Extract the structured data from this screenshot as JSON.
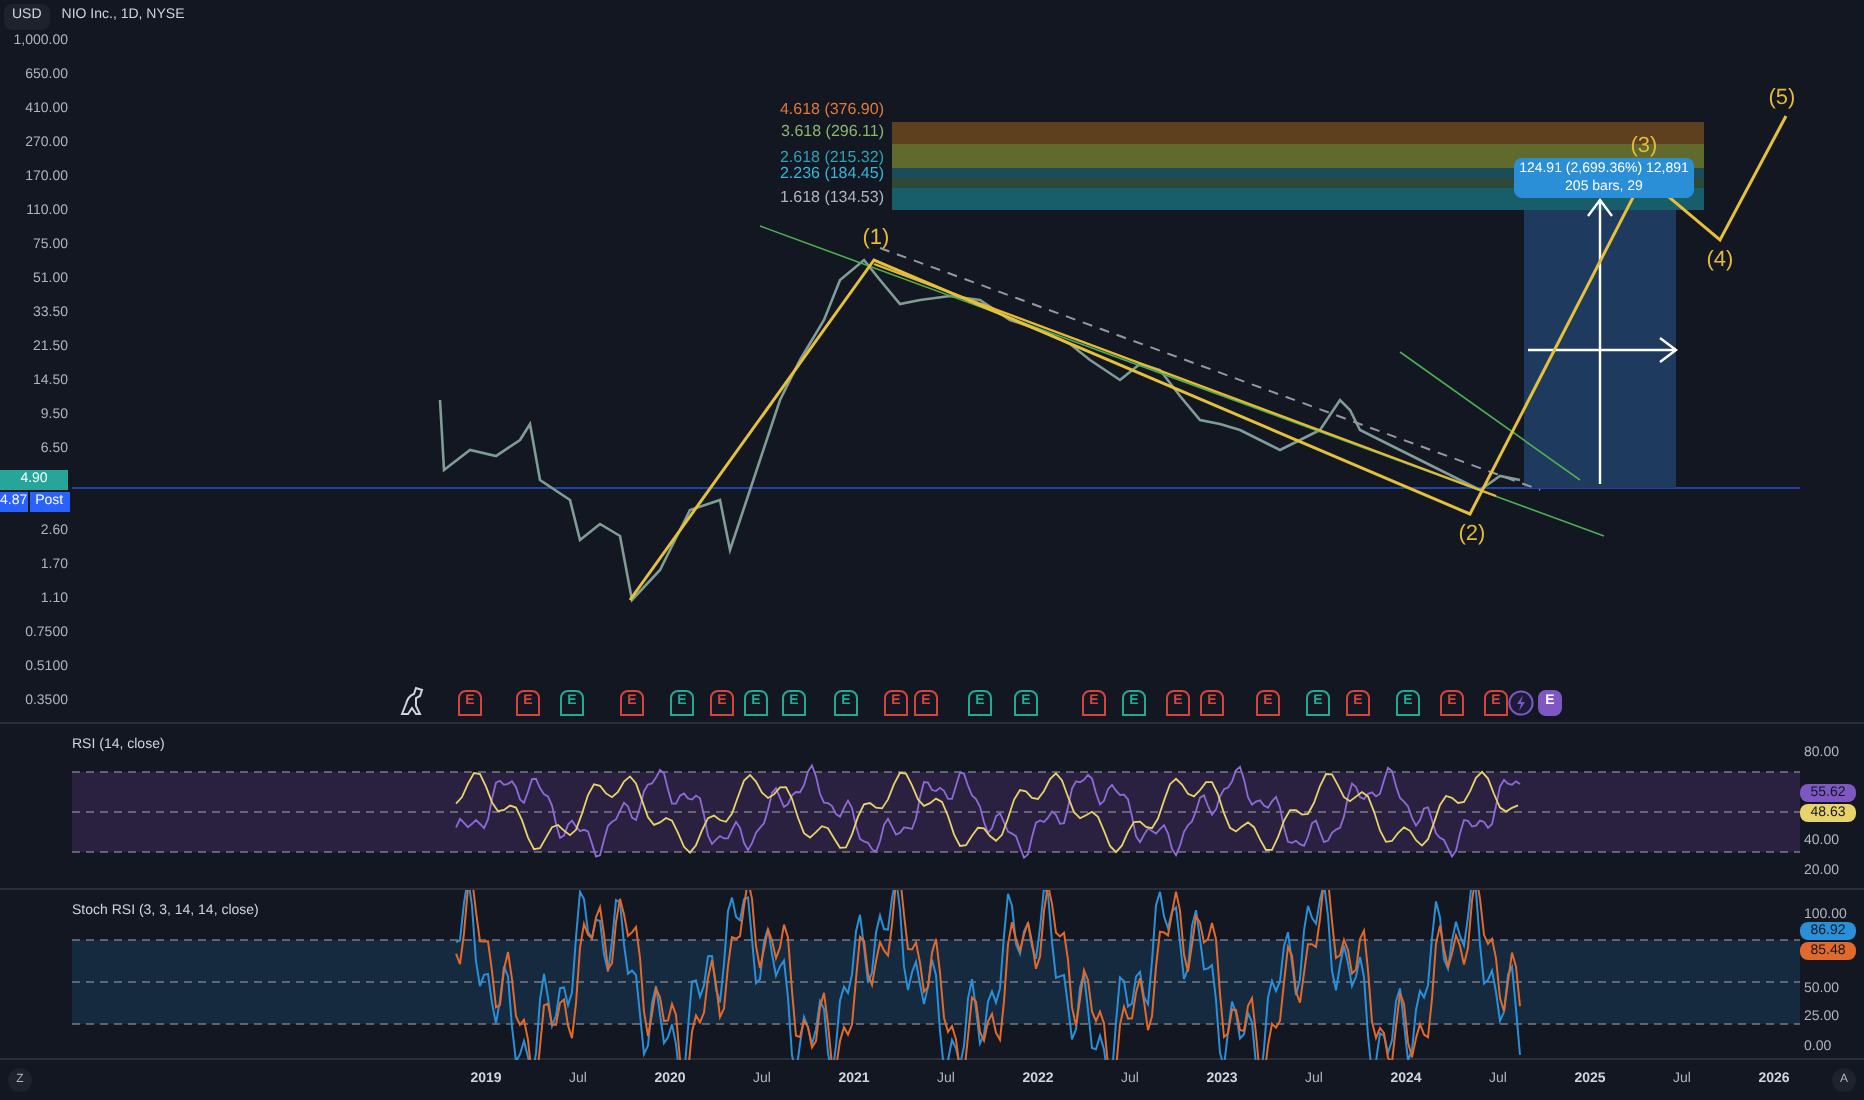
{
  "header": {
    "currency": "USD",
    "title": "NIO Inc., 1D, NYSE"
  },
  "price_axis": [
    "1,000.00",
    "650.00",
    "410.00",
    "270.00",
    "170.00",
    "110.00",
    "75.00",
    "51.00",
    "33.50",
    "21.50",
    "14.50",
    "9.50",
    "6.50",
    "2.60",
    "1.70",
    "1.10",
    "0.7500",
    "0.5100",
    "0.3500"
  ],
  "price_badges": [
    {
      "label": "4.90",
      "color": "#26a69a"
    },
    {
      "label": "4.87",
      "color": "#2962ff",
      "tag": "Post"
    }
  ],
  "fib_levels": [
    {
      "label": "4.618 (376.90)",
      "color": "#e0793b"
    },
    {
      "label": "3.618 (296.11)",
      "color": "#8bb66e"
    },
    {
      "label": "2.618 (215.32)",
      "color": "#2aa3b8"
    },
    {
      "label": "2.236 (184.45)",
      "color": "#38b6d8"
    },
    {
      "label": "1.618 (134.53)",
      "color": "#b2b5be"
    }
  ],
  "measure": {
    "line_1": "124.91 (2,699.36%) 12,891",
    "line_2": "205 bars, 29"
  },
  "waves": [
    "(1)",
    "(2)",
    "(3)",
    "(4)",
    "(5)"
  ],
  "events": [
    {
      "kind": "dino"
    },
    {
      "kind": "earnings",
      "label": "E",
      "color": "#d6453d"
    },
    {
      "kind": "earnings",
      "label": "E",
      "color": "#d6453d"
    },
    {
      "kind": "earnings",
      "label": "E",
      "color": "#22ab94"
    },
    {
      "kind": "earnings",
      "label": "E",
      "color": "#d6453d"
    },
    {
      "kind": "earnings",
      "label": "E",
      "color": "#22ab94"
    },
    {
      "kind": "earnings",
      "label": "E",
      "color": "#d6453d"
    },
    {
      "kind": "earnings",
      "label": "E",
      "color": "#22ab94"
    },
    {
      "kind": "earnings",
      "label": "E",
      "color": "#22ab94"
    },
    {
      "kind": "earnings",
      "label": "E",
      "color": "#22ab94"
    },
    {
      "kind": "earnings",
      "label": "E",
      "color": "#d6453d"
    },
    {
      "kind": "earnings",
      "label": "E",
      "color": "#d6453d"
    },
    {
      "kind": "earnings",
      "label": "E",
      "color": "#22ab94"
    },
    {
      "kind": "earnings",
      "label": "E",
      "color": "#22ab94"
    },
    {
      "kind": "earnings",
      "label": "E",
      "color": "#d6453d"
    },
    {
      "kind": "earnings",
      "label": "E",
      "color": "#22ab94"
    },
    {
      "kind": "earnings",
      "label": "E",
      "color": "#d6453d"
    },
    {
      "kind": "earnings",
      "label": "E",
      "color": "#d6453d"
    },
    {
      "kind": "earnings",
      "label": "E",
      "color": "#d6453d"
    },
    {
      "kind": "earnings",
      "label": "E",
      "color": "#22ab94"
    },
    {
      "kind": "earnings",
      "label": "E",
      "color": "#d6453d"
    },
    {
      "kind": "earnings",
      "label": "E",
      "color": "#22ab94"
    },
    {
      "kind": "earnings",
      "label": "E",
      "color": "#d6453d"
    },
    {
      "kind": "earnings",
      "label": "E",
      "color": "#d6453d"
    },
    {
      "kind": "split",
      "color": "#7e57c2"
    },
    {
      "kind": "earnings_filled",
      "label": "E",
      "color": "#7e57c2"
    }
  ],
  "rsi": {
    "title": "RSI (14, close)",
    "axis": [
      "80.00",
      "40.00",
      "20.00"
    ],
    "values": [
      {
        "label": "55.62",
        "color": "#7e57c2"
      },
      {
        "label": "48.63",
        "color": "#e8d36a"
      }
    ]
  },
  "stoch": {
    "title": "Stoch RSI (3, 3, 14, 14, close)",
    "axis": [
      "100.00",
      "50.00",
      "25.00",
      "0.00"
    ],
    "values": [
      {
        "label": "86.92",
        "color": "#2a8fd6"
      },
      {
        "label": "85.48",
        "color": "#e0692b"
      }
    ]
  },
  "time_axis": [
    "2019",
    "Jul",
    "2020",
    "Jul",
    "2021",
    "Jul",
    "2022",
    "Jul",
    "2023",
    "Jul",
    "2024",
    "Jul",
    "2025",
    "Jul",
    "2026"
  ],
  "corner_buttons": [
    "Z",
    "A"
  ]
}
